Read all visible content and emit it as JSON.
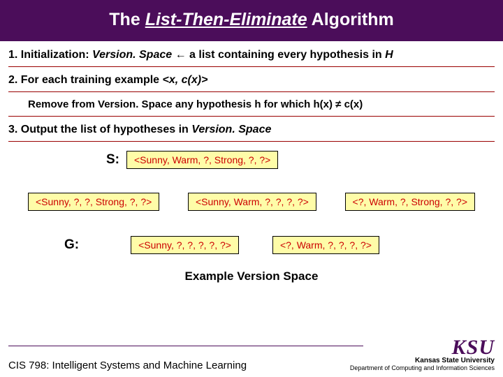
{
  "title": {
    "pre": "The ",
    "mid": "List-Then-Eliminate",
    "post": " Algorithm"
  },
  "step1": {
    "label": "1. Initialization: ",
    "vs": "Version. Space",
    "arrow": " ← ",
    "rest": "a list containing every hypothesis in ",
    "H": "H"
  },
  "step2": {
    "label": "2. For each training example ",
    "ex": "<x, c(x)>"
  },
  "substep": {
    "a": "Remove from ",
    "vs": "Version. Space",
    "b": " any hypothesis ",
    "h": "h",
    "c": " for which ",
    "hx": "h(x)",
    "ne": " ≠ ",
    "cx": "c(x)"
  },
  "step3": {
    "label": "3. Output the list of hypotheses in ",
    "vs": "Version. Space"
  },
  "vs": {
    "s_label": "S:",
    "g_label": "G:",
    "s_box": "<Sunny, Warm, ?, Strong, ?, ?>",
    "mid": [
      "<Sunny, ?, ?, Strong, ?, ?>",
      "<Sunny, Warm, ?, ?, ?, ?>",
      "<?, Warm, ?, Strong, ?, ?>"
    ],
    "g": [
      "<Sunny, ?, ?, ?, ?, ?>",
      "<?, Warm, ?, ?, ?, ?>"
    ],
    "caption": "Example Version Space"
  },
  "footer": {
    "course": "CIS 798: Intelligent Systems and Machine Learning",
    "ksu": "KSU",
    "uni": "Kansas State University",
    "dept": "Department of Computing and Information Sciences"
  }
}
